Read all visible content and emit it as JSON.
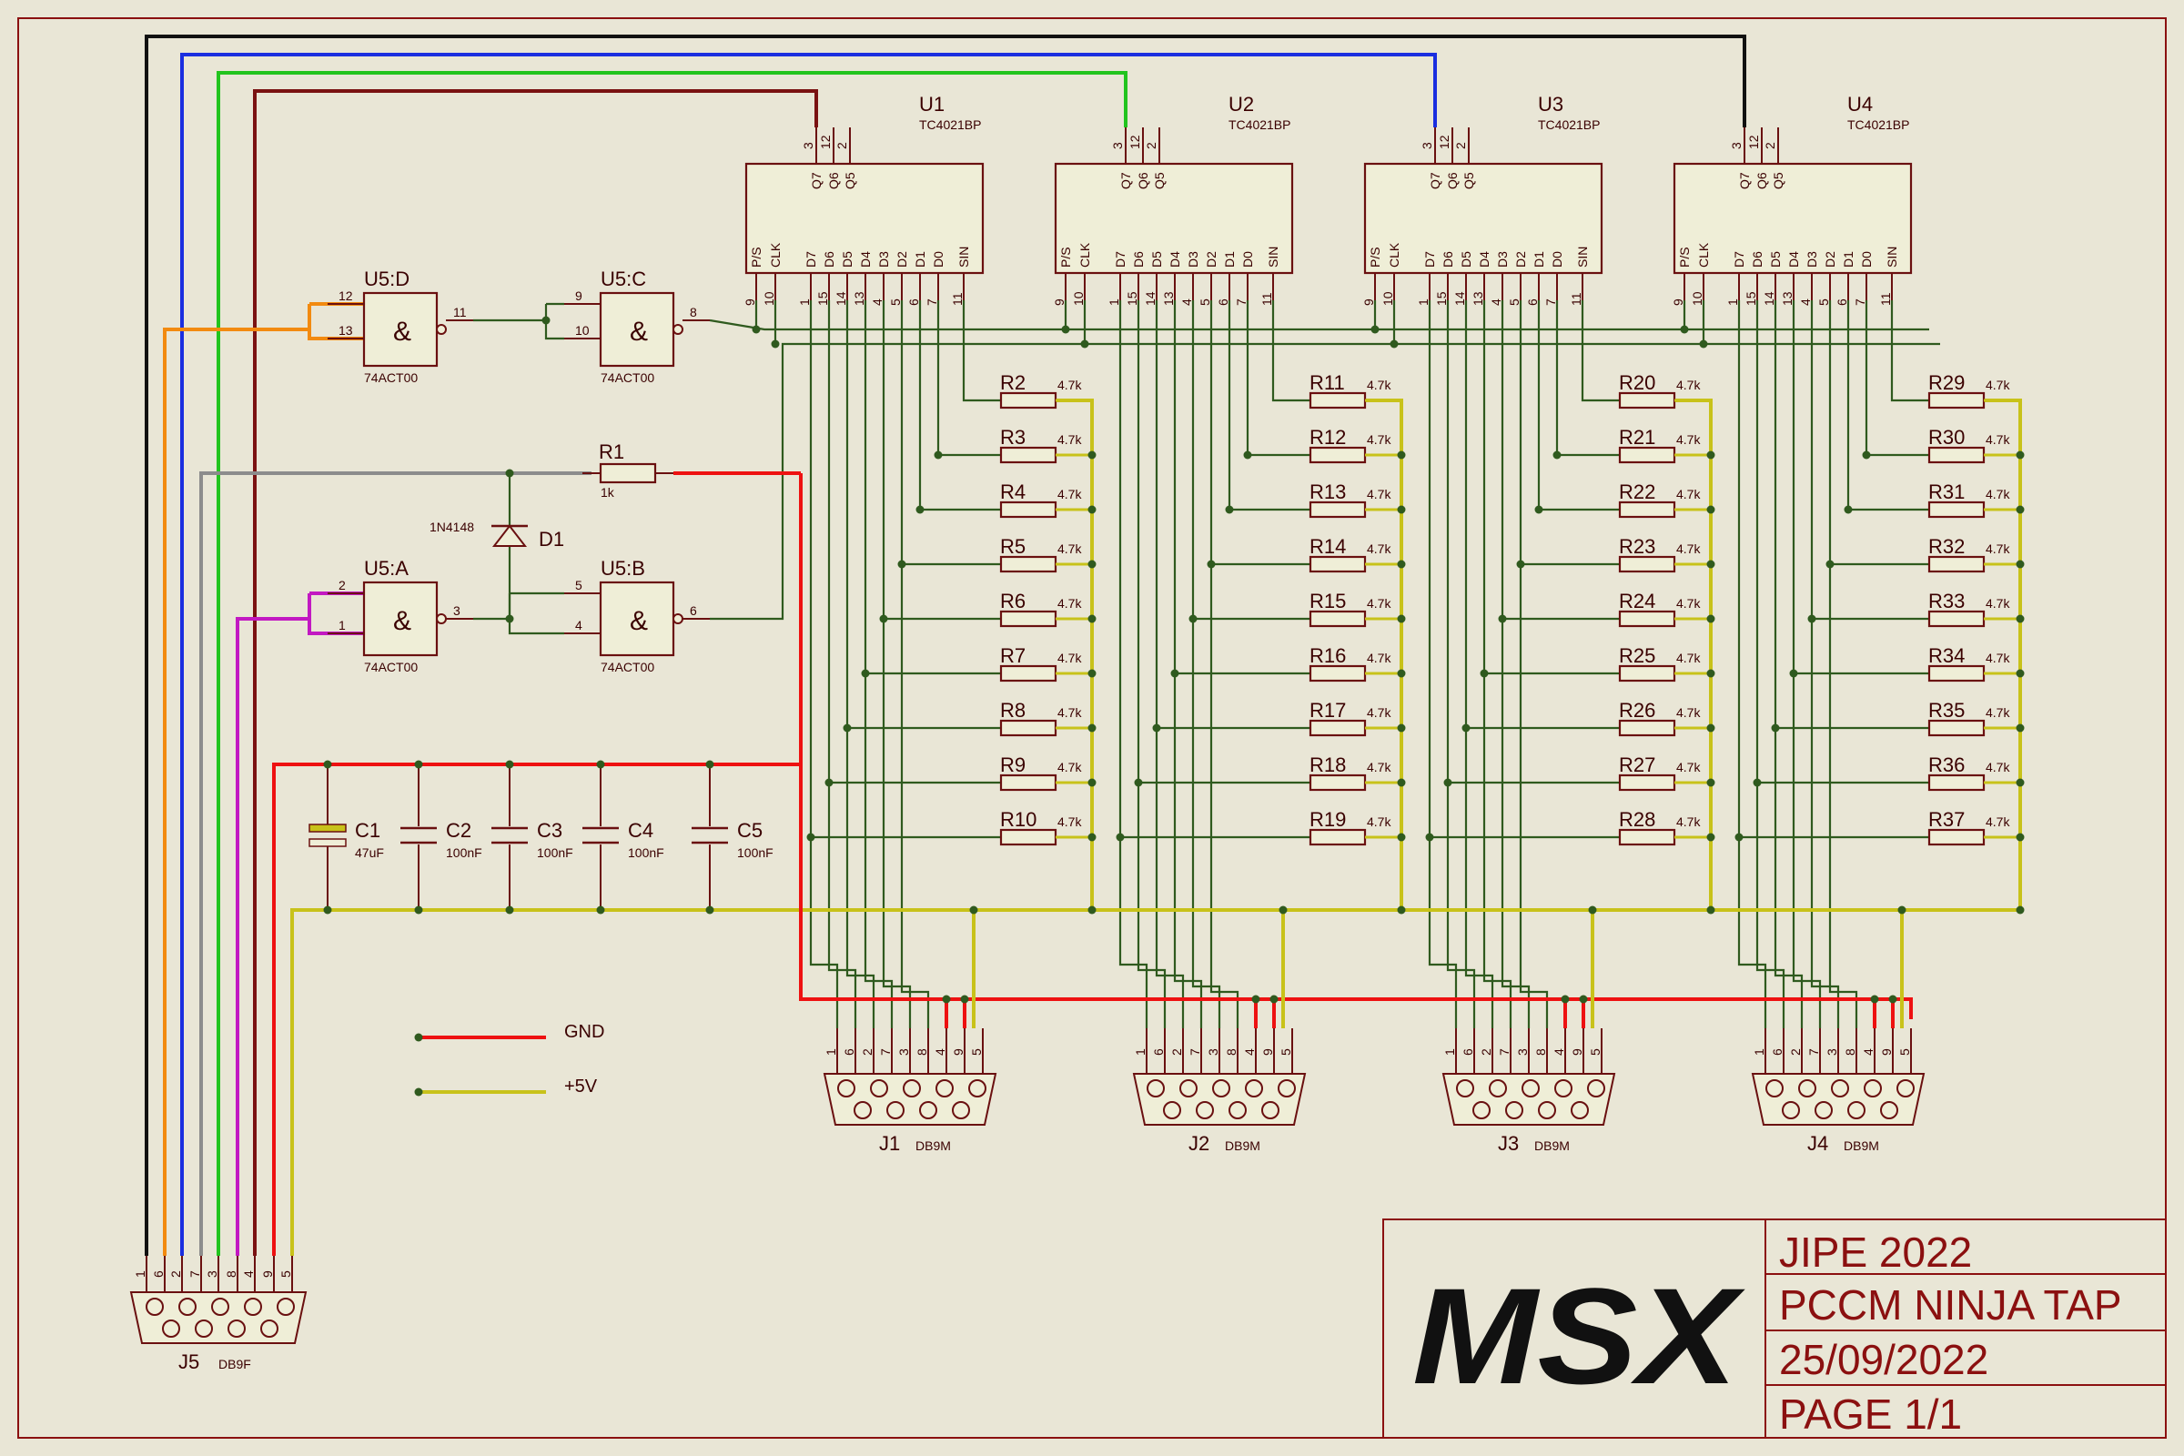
{
  "chips": [
    {
      "ref": "U1",
      "part": "TC4021BP"
    },
    {
      "ref": "U2",
      "part": "TC4021BP"
    },
    {
      "ref": "U3",
      "part": "TC4021BP"
    },
    {
      "ref": "U4",
      "part": "TC4021BP"
    }
  ],
  "chip_top_pins": [
    "3",
    "12",
    "2"
  ],
  "chip_top_labels": [
    "Q7",
    "Q6",
    "Q5"
  ],
  "chip_bottom_pins": [
    "9",
    "10",
    "1",
    "15",
    "14",
    "13",
    "4",
    "5",
    "6",
    "7",
    "11"
  ],
  "chip_bottom_labels": [
    "P/S",
    "CLK",
    "D7",
    "D6",
    "D5",
    "D4",
    "D3",
    "D2",
    "D1",
    "D0",
    "SIN"
  ],
  "resistor_value": "4.7k",
  "resistors": [
    [
      "R2",
      "R3",
      "R4",
      "R5",
      "R6",
      "R7",
      "R8",
      "R9",
      "R10"
    ],
    [
      "R11",
      "R12",
      "R13",
      "R14",
      "R15",
      "R16",
      "R17",
      "R18",
      "R19"
    ],
    [
      "R20",
      "R21",
      "R22",
      "R23",
      "R24",
      "R25",
      "R26",
      "R27",
      "R28"
    ],
    [
      "R29",
      "R30",
      "R31",
      "R32",
      "R33",
      "R34",
      "R35",
      "R36",
      "R37"
    ]
  ],
  "gates": [
    {
      "ref": "U5:D",
      "part": "74ACT00",
      "in1": "12",
      "in2": "13",
      "out": "11"
    },
    {
      "ref": "U5:C",
      "part": "74ACT00",
      "in1": "9",
      "in2": "10",
      "out": "8"
    },
    {
      "ref": "U5:A",
      "part": "74ACT00",
      "in1": "2",
      "in2": "1",
      "out": "3"
    },
    {
      "ref": "U5:B",
      "part": "74ACT00",
      "in1": "5",
      "in2": "4",
      "out": "6"
    }
  ],
  "gate_symbol": "&",
  "r1": {
    "ref": "R1",
    "value": "1k"
  },
  "d1": {
    "ref": "D1",
    "part": "1N4148"
  },
  "caps": [
    {
      "ref": "C1",
      "value": "47uF"
    },
    {
      "ref": "C2",
      "value": "100nF"
    },
    {
      "ref": "C3",
      "value": "100nF"
    },
    {
      "ref": "C4",
      "value": "100nF"
    },
    {
      "ref": "C5",
      "value": "100nF"
    }
  ],
  "connectors": [
    {
      "ref": "J1",
      "type": "DB9M"
    },
    {
      "ref": "J2",
      "type": "DB9M"
    },
    {
      "ref": "J3",
      "type": "DB9M"
    },
    {
      "ref": "J4",
      "type": "DB9M"
    }
  ],
  "connector_pins": [
    "1",
    "6",
    "2",
    "7",
    "3",
    "8",
    "4",
    "9",
    "5"
  ],
  "j5": {
    "ref": "J5",
    "type": "DB9F"
  },
  "legend": {
    "gnd": "GND",
    "vcc": "+5V"
  },
  "colors": {
    "background": "#e9e6d6",
    "signal": "#2f5a1e",
    "gnd": "#ee1111",
    "vcc": "#c8c21a",
    "wire_black": "#111111",
    "wire_blue": "#1a2ee0",
    "wire_green": "#22c41e",
    "wire_darkred": "#7a1212",
    "wire_orange": "#f28a10",
    "wire_gray": "#8c8c8c",
    "wire_magenta": "#c218c2"
  },
  "title_block": {
    "logo": "MSX",
    "line1": "JIPE 2022",
    "line2": "PCCM NINJA TAP",
    "line3": "25/09/2022",
    "line4": "PAGE 1/1"
  }
}
